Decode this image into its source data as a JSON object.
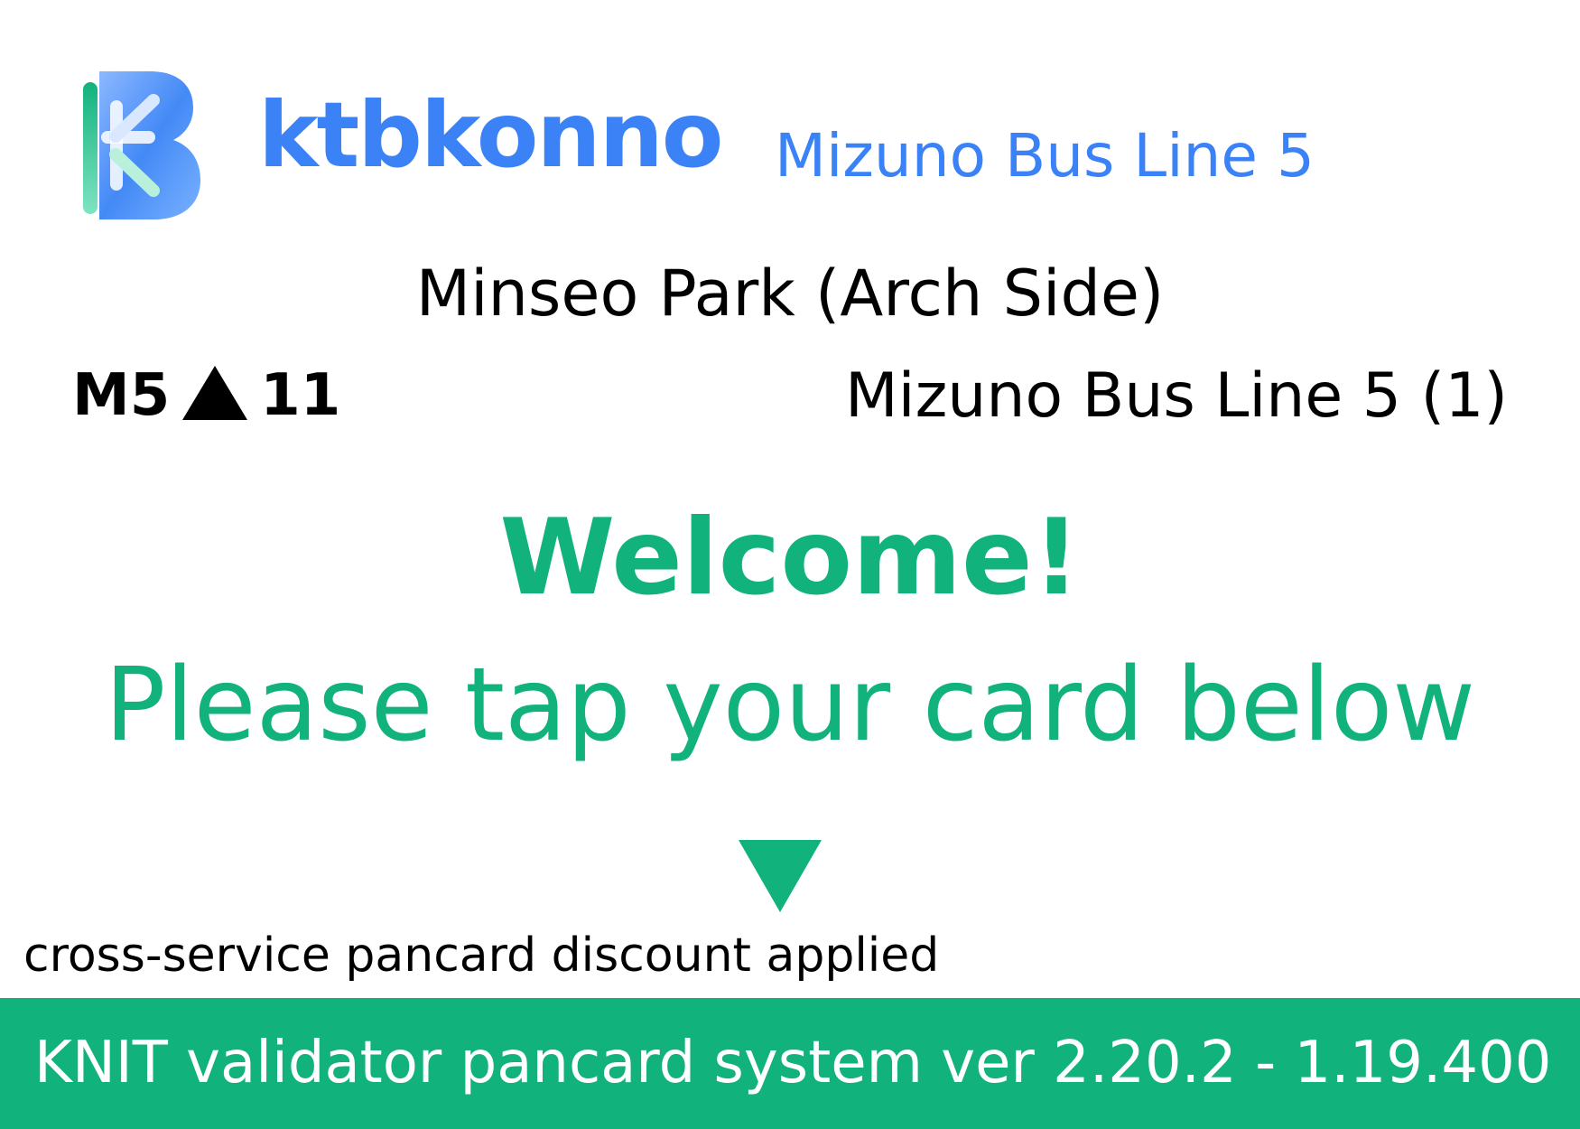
{
  "header": {
    "logo_icon": "ktbkonno-logo-icon",
    "brand": "ktbkonno",
    "line_title": "Mizuno Bus Line 5"
  },
  "stop": {
    "name": "Minseo Park (Arch Side)"
  },
  "route": {
    "prefix": "M5",
    "direction_icon": "up-triangle-icon",
    "stop_number": "11",
    "direction_label": "Mizuno Bus Line 5 (1)"
  },
  "message": {
    "welcome": "Welcome!",
    "instruction": "Please tap your card below",
    "arrow_icon": "down-triangle-icon",
    "discount_note": "cross-service pancard discount applied"
  },
  "footer": {
    "system_version": "KNIT validator pancard system ver 2.20.2 - 1.19.400"
  },
  "colors": {
    "brand_blue": "#3b82f6",
    "accent_green": "#12b27d",
    "text_black": "#000000"
  }
}
